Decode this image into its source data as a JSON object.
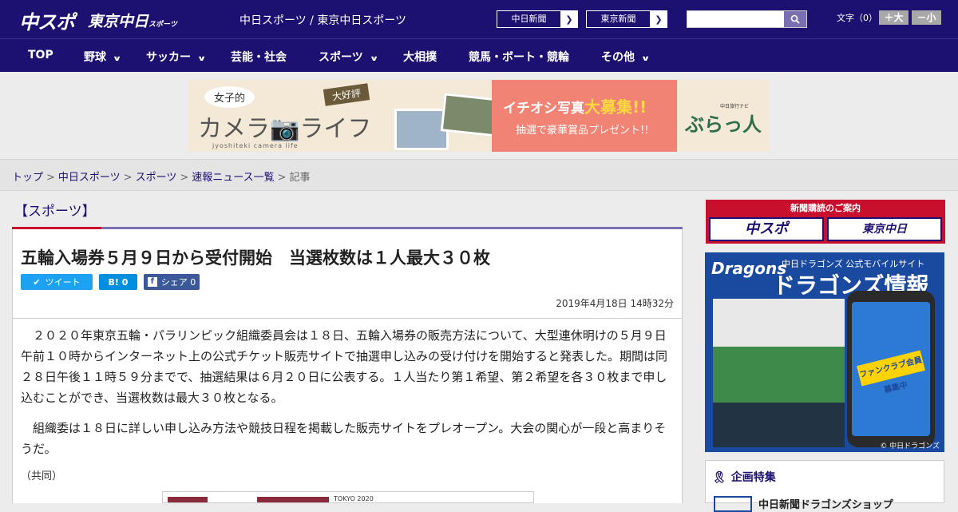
{
  "header": {
    "logo_chuspo": "中スポ",
    "logo_tokyo": "東京中日",
    "logo_tokyo_small": "スポーツ",
    "sitename": "中日スポーツ / 東京中日スポーツ",
    "link1": "中日新聞",
    "link2": "東京新聞",
    "fontsize_label": "文字（0）",
    "font_big": "＋大",
    "font_small": "－小"
  },
  "nav": {
    "items": [
      {
        "label": "TOP"
      },
      {
        "label": "野球"
      },
      {
        "label": "サッカー"
      },
      {
        "label": "芸能・社会"
      },
      {
        "label": "スポーツ"
      },
      {
        "label": "大相撲"
      },
      {
        "label": "競馬・ボート・競輪"
      },
      {
        "label": "その他"
      }
    ]
  },
  "banner": {
    "joshi": "女子的",
    "camera": "カメラ📷ライフ",
    "sub": "jyoshiteki camera life",
    "daikouhyo": "大好評",
    "ichioshi_a": "イチオシ写真",
    "ichioshi_b": "大募集!!",
    "present": "抽選で豪華賞品プレゼント!!",
    "navi": "中日旅行ナビ",
    "burattabi": "ぶらっ人"
  },
  "breadcrumb": {
    "top": "トップ",
    "chuspo": "中日スポーツ",
    "sports": "スポーツ",
    "list": "速報ニュース一覧",
    "current": "記事"
  },
  "category": "【スポーツ】",
  "article": {
    "headline": "五輪入場券５月９日から受付開始　当選枚数は１人最大３０枚",
    "tweet": "ツイート",
    "hatena": "B! 0",
    "facebook": "シェア 0",
    "date": "2019年4月18日 14時32分",
    "p1": "２０２０年東京五輪・パラリンピック組織委員会は１８日、五輪入場券の販売方法について、大型連休明けの５月９日午前１０時からインターネット上の公式チケット販売サイトで抽選申し込みの受け付けを開始すると発表した。期間は同２８日午後１１時５９分までで、抽選結果は６月２０日に公表する。１人当たり第１希望、第２希望を各３０枚まで申し込むことができ、当選枚数は最大３０枚となる。",
    "p2": "組織委は１８日に詳しい申し込み方法や競技日程を掲載した販売サイトをプレオープン。大会の関心が一段と高まりそうだ。",
    "credit": "（共同）",
    "photo_text": "TOKYO 2020"
  },
  "sidebar": {
    "ad_title": "新聞購読のご案内",
    "ad_btn1": "中スポ",
    "ad_btn2": "東京中日",
    "dragons_logo": "Dragons",
    "dragons_sub": "中日ドラゴンズ 公式モバイルサイト",
    "dragons_title": "ドラゴンズ情報",
    "dragons_phone_banner": "ファンクラブ会員募集中",
    "dragons_copy": "© 中日ドラゴンズ",
    "kikaku_title": "企画特集",
    "kikaku_item": "中日新聞ドラゴンズショップ"
  }
}
